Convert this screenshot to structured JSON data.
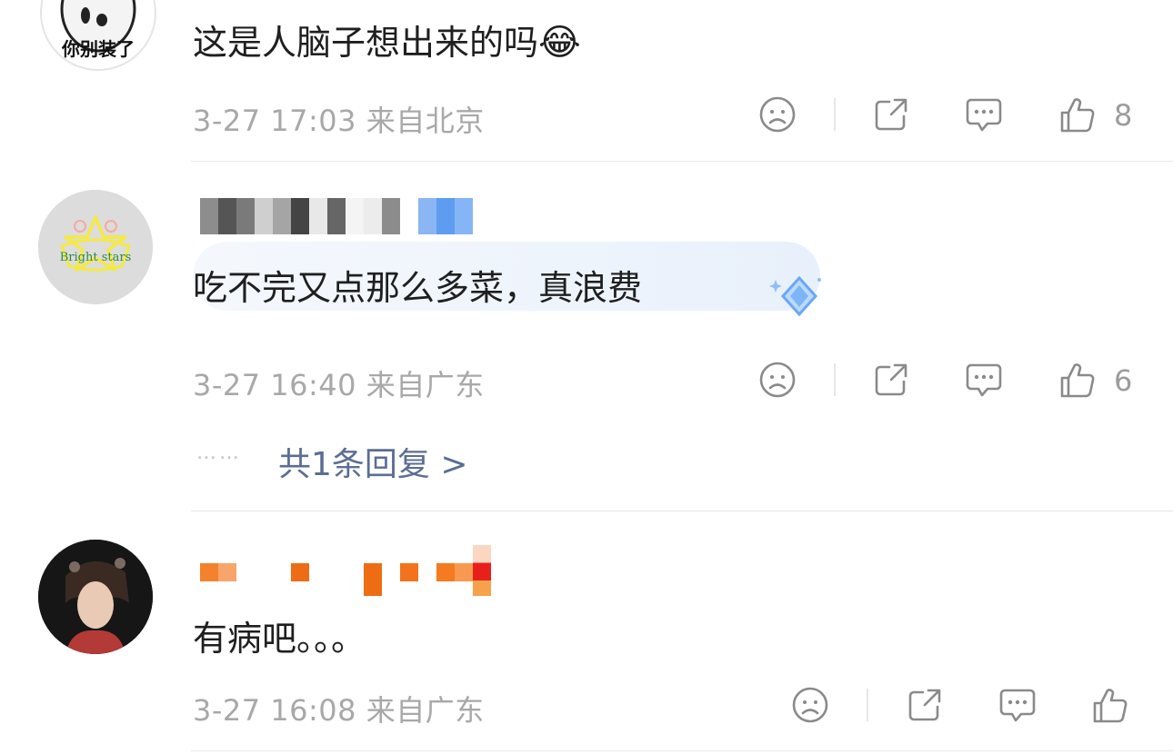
{
  "comments": [
    {
      "avatar_caption": "你别装了",
      "text": "这是人脑子想出来的吗",
      "emoji": "😂",
      "meta": "3-27 17:03 来自北京",
      "like_count": "8"
    },
    {
      "avatar_text": "Bright stars",
      "text": "吃不完又点那么多菜，真浪费",
      "meta": "3-27 16:40 来自广东",
      "like_count": "6",
      "replies_link": "共1条回复 >",
      "replies_dots": "……"
    },
    {
      "text": "有病吧。。。",
      "meta": "3-27 16:08 来自广东",
      "like_count": ""
    }
  ],
  "icons": [
    "sad-face-icon",
    "share-icon",
    "comment-icon",
    "thumbs-up-icon"
  ],
  "colors": {
    "meta_gray": "#a8a8a8",
    "link_blue": "#5b6e93",
    "divider": "#e8e8e8"
  }
}
